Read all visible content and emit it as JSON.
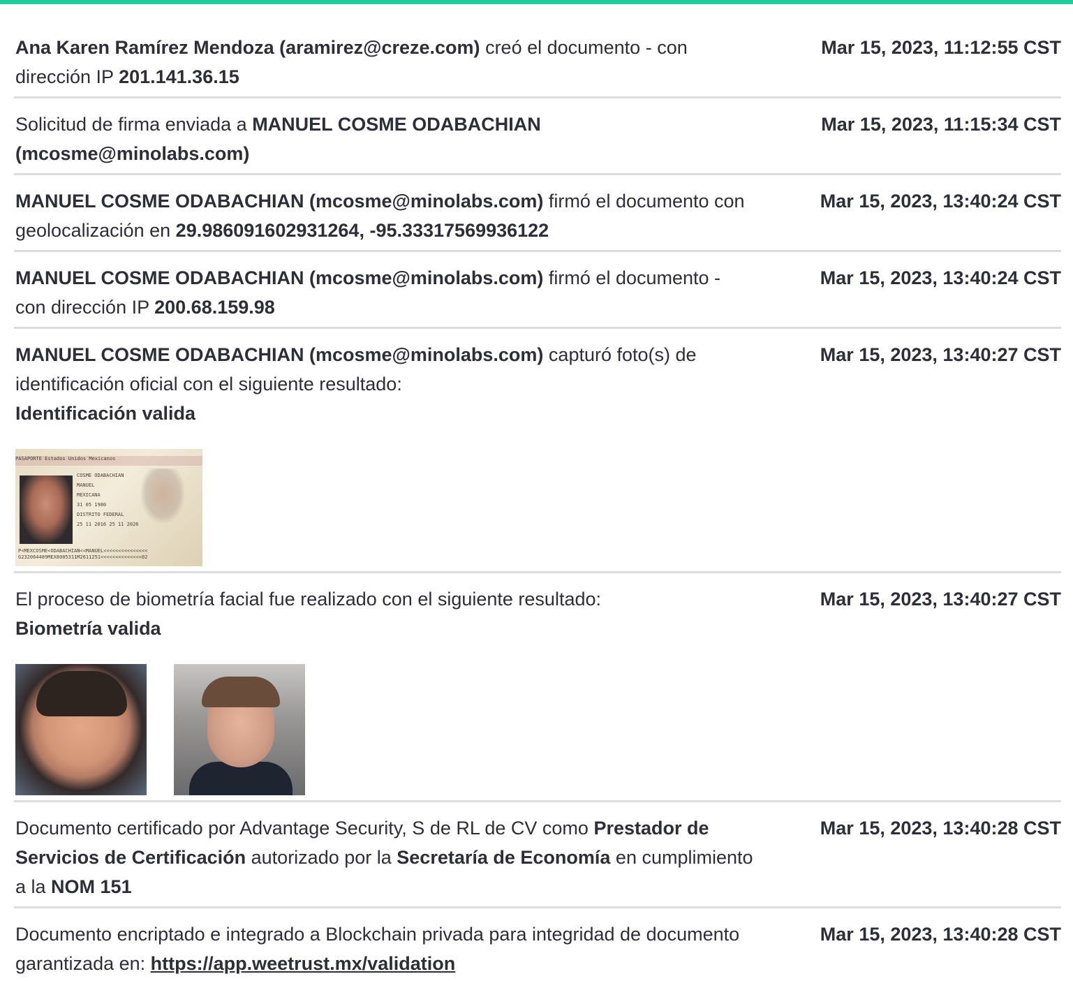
{
  "events": [
    {
      "parts": [
        {
          "t": "Ana Karen Ramírez Mendoza (aramirez@creze.com)",
          "b": true
        },
        {
          "t": " creó el documento - con dirección IP ",
          "b": false
        },
        {
          "t": "201.141.36.15",
          "b": true
        }
      ],
      "time": "Mar 15, 2023, 11:12:55 CST"
    },
    {
      "parts": [
        {
          "t": "Solicitud de firma enviada a ",
          "b": false
        },
        {
          "t": "MANUEL COSME ODABACHIAN (mcosme@minolabs.com)",
          "b": true
        }
      ],
      "time": "Mar 15, 2023, 11:15:34 CST"
    },
    {
      "parts": [
        {
          "t": "MANUEL COSME ODABACHIAN (mcosme@minolabs.com)",
          "b": true
        },
        {
          "t": " firmó el documento con geolocalización en ",
          "b": false
        },
        {
          "t": "29.986091602931264, -95.33317569936122",
          "b": true
        }
      ],
      "time": "Mar 15, 2023, 13:40:24 CST"
    },
    {
      "parts": [
        {
          "t": "MANUEL COSME ODABACHIAN (mcosme@minolabs.com)",
          "b": true
        },
        {
          "t": " firmó el documento - con dirección IP ",
          "b": false
        },
        {
          "t": "200.68.159.98",
          "b": true
        }
      ],
      "time": "Mar 15, 2023, 13:40:24 CST"
    },
    {
      "parts": [
        {
          "t": "MANUEL COSME ODABACHIAN (mcosme@minolabs.com)",
          "b": true
        },
        {
          "t": " capturó foto(s) de identificación oficial con el siguiente resultado:",
          "b": false
        }
      ],
      "result": "Identificación valida",
      "images": [
        "passport"
      ],
      "time": "Mar 15, 2023, 13:40:27 CST"
    },
    {
      "parts": [
        {
          "t": "El proceso de biometría facial fue realizado con el siguiente resultado:",
          "b": false
        }
      ],
      "result": "Biometría valida",
      "images": [
        "face-id",
        "face-selfie"
      ],
      "time": "Mar 15, 2023, 13:40:27 CST"
    },
    {
      "parts": [
        {
          "t": "Documento certificado por Advantage Security, S de RL de CV como ",
          "b": false
        },
        {
          "t": "Prestador de Servicios de Certificación",
          "b": true
        },
        {
          "t": " autorizado por la ",
          "b": false
        },
        {
          "t": "Secretaría de Economía",
          "b": true
        },
        {
          "t": " en cumplimiento a la ",
          "b": false
        },
        {
          "t": "NOM 151",
          "b": true
        }
      ],
      "time": "Mar 15, 2023, 13:40:28 CST"
    },
    {
      "parts": [
        {
          "t": "Documento encriptado e integrado a Blockchain privada para integridad de documento garantizada en: ",
          "b": false
        }
      ],
      "link": "https://app.weetrust.mx/validation",
      "time": "Mar 15, 2023, 13:40:28 CST"
    }
  ],
  "passport": {
    "header": "PASAPORTE   Estados Unidos Mexicanos",
    "lines": [
      "COSME ODABACHIAN",
      "MANUEL",
      "MEXICANA",
      "31 05 1980",
      "DISTRITO FEDERAL",
      "25 11 2016    25 11 2026"
    ],
    "mrz": [
      "P<MEXCOSME<ODABACHIAN<<MANUEL<<<<<<<<<<<<<<<",
      "G232064489MEX8005311M2611251<<<<<<<<<<<<<<02"
    ]
  }
}
